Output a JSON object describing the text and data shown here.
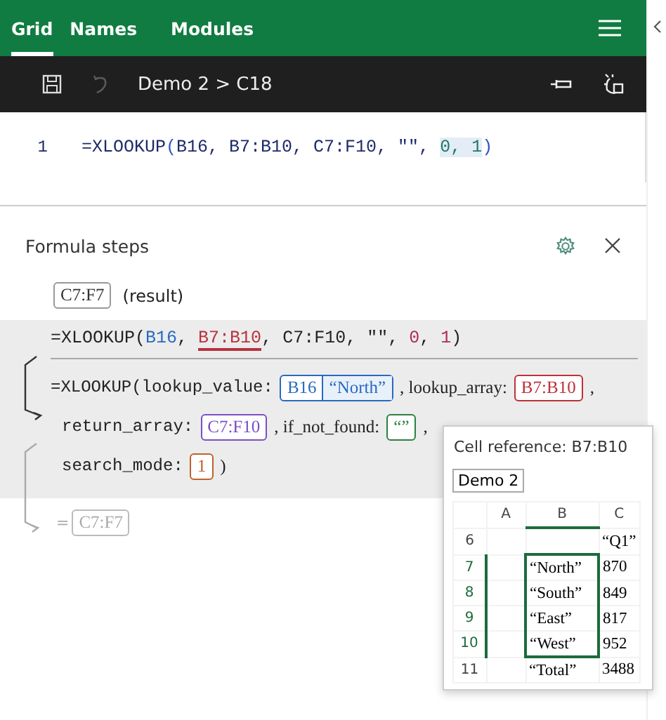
{
  "tabs": [
    {
      "label": "Grid",
      "selected": true
    },
    {
      "label": "Names",
      "selected": false
    },
    {
      "label": "Modules",
      "selected": false
    }
  ],
  "toolbar": {
    "undo_disabled": true,
    "breadcrumb": "Demo 2 > C18"
  },
  "editor": {
    "line_number": "1",
    "tokens": [
      {
        "kind": "name",
        "text": "=XLOOKUP"
      },
      {
        "kind": "paren",
        "text": "("
      },
      {
        "kind": "name",
        "text": "B16, B7:B10, C7:F10, \"\", "
      },
      {
        "kind": "number",
        "text": "0, 1"
      },
      {
        "kind": "paren",
        "text": ")"
      }
    ]
  },
  "steps": {
    "title": "Formula steps",
    "result": {
      "ref": "C7:F7",
      "note": "(result)"
    },
    "formula": [
      {
        "text": "=XLOOKUP("
      },
      {
        "text": "B16",
        "color": "#2a6ac0"
      },
      {
        "text": ", "
      },
      {
        "text": "B7:B10",
        "color": "#b8323c",
        "underlined": true
      },
      {
        "text": ", C7:F10, \"\", "
      },
      {
        "text": "0",
        "color": "#b02a5a"
      },
      {
        "text": ", "
      },
      {
        "text": "1",
        "color": "#b02a5a"
      },
      {
        "text": ")"
      }
    ],
    "expanded": [
      [
        {
          "kind": "text",
          "text": "=XLOOKUP(lookup_value:"
        },
        {
          "kind": "pair",
          "ref": "B16",
          "value": "“North”",
          "color": "#2a6ac0"
        },
        {
          "kind": "text",
          "text": ", lookup_array:"
        },
        {
          "kind": "chip",
          "ref": "B7:B10",
          "color": "#c0303a"
        },
        {
          "kind": "text",
          "text": ","
        }
      ],
      [
        {
          "kind": "text",
          "text": "return_array:"
        },
        {
          "kind": "chip",
          "ref": "C7:F10",
          "color": "#7b4fc4"
        },
        {
          "kind": "text",
          "text": ", if_not_found:"
        },
        {
          "kind": "chip",
          "ref": "“”",
          "color": "#2e8040"
        },
        {
          "kind": "text",
          "text": ","
        }
      ],
      [
        {
          "kind": "text",
          "text": "search_mode:"
        },
        {
          "kind": "chip",
          "ref": "1",
          "color": "#c0602a"
        },
        {
          "kind": "text",
          "text": ")"
        }
      ]
    ],
    "final": {
      "prefix": "=",
      "ref": "C7:F7"
    }
  },
  "tooltip": {
    "title": "Cell reference: B7:B10",
    "sheet": "Demo 2",
    "columns": [
      {
        "label": "A",
        "selected": false
      },
      {
        "label": "B",
        "selected": true
      },
      {
        "label": "C",
        "selected": false
      }
    ],
    "rows": [
      {
        "number": "6",
        "b": null,
        "c": "“Q1”",
        "selected": false
      },
      {
        "number": "7",
        "b": "“North”",
        "c": "870",
        "selected": true
      },
      {
        "number": "8",
        "b": "“South”",
        "c": "849",
        "selected": true
      },
      {
        "number": "9",
        "b": "“East”",
        "c": "817",
        "selected": true
      },
      {
        "number": "10",
        "b": "“West”",
        "c": "952",
        "selected": true
      },
      {
        "number": "11",
        "b": "“Total”",
        "c": "3488",
        "selected": false
      }
    ]
  }
}
